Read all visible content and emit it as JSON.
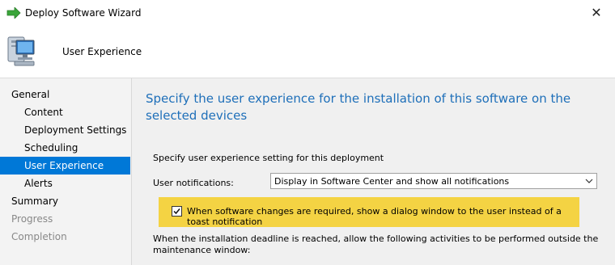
{
  "window": {
    "title": "Deploy Software Wizard",
    "close_symbol": "✕",
    "app_icon": "green-arrow-icon"
  },
  "header": {
    "page_name": "User Experience",
    "icon": "computer-icon"
  },
  "sidebar": {
    "items": [
      {
        "label": "General",
        "state": "normal",
        "level": "top"
      },
      {
        "label": "Content",
        "state": "normal",
        "level": "sub"
      },
      {
        "label": "Deployment Settings",
        "state": "normal",
        "level": "sub"
      },
      {
        "label": "Scheduling",
        "state": "normal",
        "level": "sub"
      },
      {
        "label": "User Experience",
        "state": "active",
        "level": "sub"
      },
      {
        "label": "Alerts",
        "state": "normal",
        "level": "sub"
      },
      {
        "label": "Summary",
        "state": "normal",
        "level": "top"
      },
      {
        "label": "Progress",
        "state": "disabled",
        "level": "top"
      },
      {
        "label": "Completion",
        "state": "disabled",
        "level": "top"
      }
    ]
  },
  "main": {
    "heading": "Specify the user experience for the installation of this software on the selected devices",
    "description": "Specify user experience setting for this deployment",
    "notifications_label": "User notifications:",
    "notifications_value": "Display in Software Center and show all notifications",
    "dialog_checkbox_label": "When software changes are required, show a dialog window to the user instead of a toast notification",
    "dialog_checkbox_checked": true,
    "maintenance_text": "When the installation deadline is reached, allow the following activities to be performed outside the maintenance window:"
  },
  "colors": {
    "accent": "#0078d7",
    "heading": "#1e6fb9",
    "highlight": "#f4d343"
  }
}
